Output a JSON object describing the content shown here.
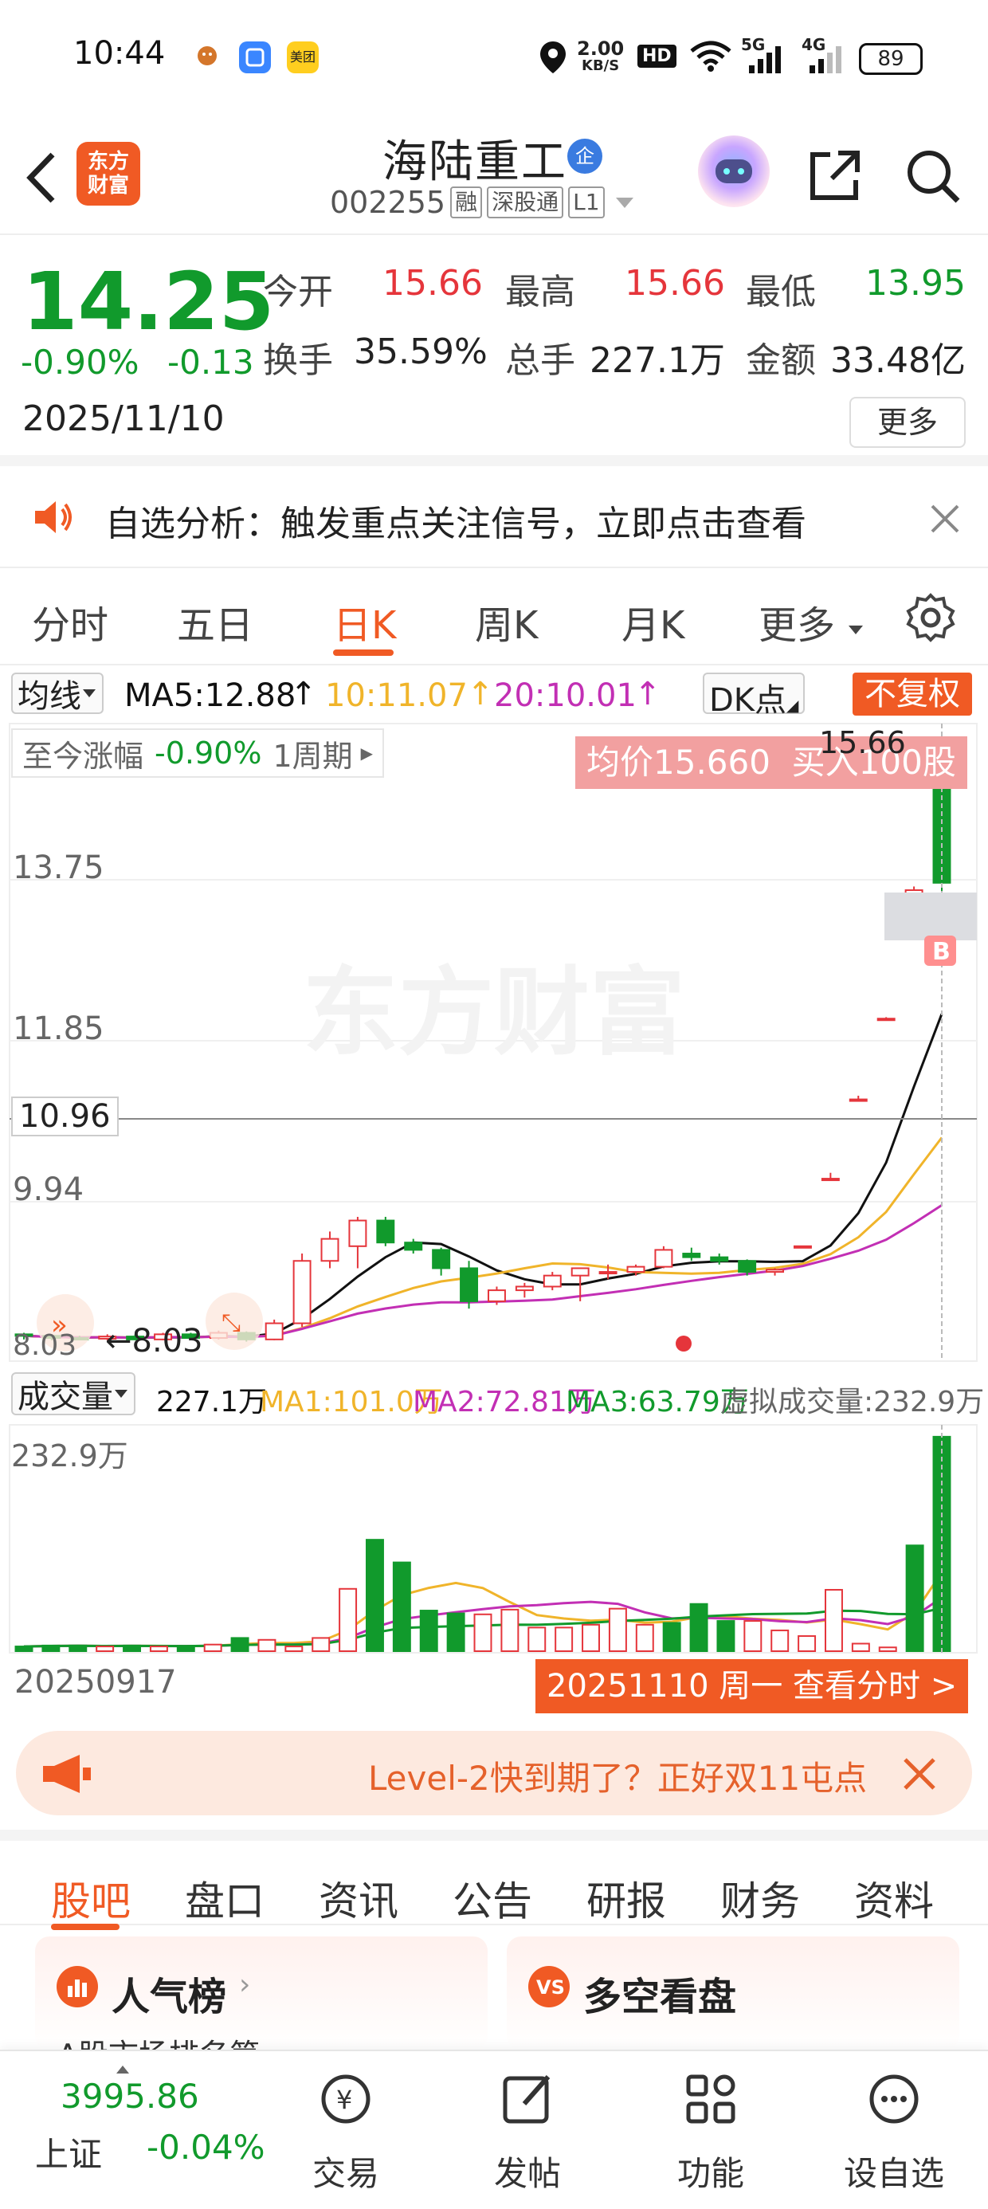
{
  "status_bar": {
    "time": "10:44",
    "net_speed_value": "2.00",
    "net_speed_unit": "KB/S",
    "hd_label": "HD",
    "sig1_label": "5G",
    "sig2_label": "4G",
    "battery": "89",
    "app3_label": "美团"
  },
  "header": {
    "logo_line1": "东方",
    "logo_line2": "财富",
    "stock_name": "海陆重工",
    "badge": "企",
    "stock_code": "002255",
    "tags": [
      "融",
      "深股通",
      "L1"
    ]
  },
  "quote": {
    "price": "14.25",
    "change_pct": "-0.90%",
    "change_amt": "-0.13",
    "date": "2025/11/10",
    "open_label": "今开",
    "open": "15.66",
    "high_label": "最高",
    "high": "15.66",
    "low_label": "最低",
    "low": "13.95",
    "turnover_label": "换手",
    "turnover": "35.59%",
    "volume_label": "总手",
    "volume": "227.1万",
    "amount_label": "金额",
    "amount": "33.48亿",
    "more_label": "更多"
  },
  "analysis": {
    "text": "自选分析：触发重点关注信号，立即点击查看"
  },
  "chart_tabs": [
    "分时",
    "五日",
    "日K",
    "周K",
    "月K",
    "更多"
  ],
  "ma_bar": {
    "ma_select": "均线",
    "ma5": "MA5:12.88",
    "ma10": "10:11.07",
    "ma20": "20:10.01",
    "dk": "DK点",
    "adjust": "不复权"
  },
  "chart_overlay": {
    "period_label": "至今涨幅",
    "period_change": "-0.90%",
    "period_count": "1周期",
    "trade_banner": "均价15.660  买入100股",
    "max_label": "15.66",
    "min_label": "8.03",
    "buy_marker": "B",
    "crosshair_price": "10.96",
    "watermark": "东方财富",
    "y_ticks": [
      "13.75",
      "11.85",
      "9.94",
      "8.03"
    ]
  },
  "volume_bar": {
    "select": "成交量",
    "current": "227.1万",
    "ma1": "MA1:101.0万",
    "ma2": "MA2:72.81万",
    "ma3": "MA3:63.79万",
    "virtual": "虚拟成交量:232.9万",
    "max_label": "232.9万"
  },
  "x_axis": {
    "start_date": "20250917",
    "cursor_label": "20251110 周一 查看分时 >"
  },
  "colors": {
    "up": "#e5353b",
    "down": "#119a2c",
    "ma5": "#111111",
    "ma10": "#f0b42a",
    "ma20": "#c22fb4",
    "accent": "#f05a24"
  },
  "chart_data": {
    "type": "candlestick",
    "x": [
      "20250917",
      "20251110"
    ],
    "ohlc": [
      [
        8.1,
        8.12,
        8.03,
        8.08
      ],
      [
        8.08,
        8.1,
        8.02,
        8.05
      ],
      [
        8.05,
        8.08,
        8.02,
        8.04
      ],
      [
        8.04,
        8.1,
        8.02,
        8.07
      ],
      [
        8.07,
        8.1,
        8.02,
        8.03
      ],
      [
        8.03,
        8.12,
        8.02,
        8.1
      ],
      [
        8.1,
        8.12,
        8.03,
        8.05
      ],
      [
        8.05,
        8.15,
        8.03,
        8.12
      ],
      [
        8.12,
        8.14,
        8.0,
        8.03
      ],
      [
        8.03,
        8.3,
        8.02,
        8.25
      ],
      [
        8.25,
        9.2,
        8.2,
        9.1
      ],
      [
        9.1,
        9.5,
        9.0,
        9.4
      ],
      [
        9.3,
        9.7,
        9.0,
        9.65
      ],
      [
        9.65,
        9.7,
        9.3,
        9.35
      ],
      [
        9.35,
        9.4,
        9.2,
        9.25
      ],
      [
        9.25,
        9.28,
        8.9,
        9.0
      ],
      [
        9.0,
        9.1,
        8.45,
        8.55
      ],
      [
        8.55,
        8.75,
        8.5,
        8.7
      ],
      [
        8.7,
        8.8,
        8.6,
        8.75
      ],
      [
        8.75,
        8.95,
        8.7,
        8.9
      ],
      [
        8.9,
        9.0,
        8.55,
        9.0
      ],
      [
        8.95,
        9.05,
        8.85,
        8.95
      ],
      [
        8.95,
        9.05,
        8.9,
        9.02
      ],
      [
        9.02,
        9.3,
        9.0,
        9.25
      ],
      [
        9.2,
        9.28,
        9.1,
        9.15
      ],
      [
        9.15,
        9.2,
        9.05,
        9.1
      ],
      [
        9.1,
        9.12,
        8.9,
        8.95
      ],
      [
        8.95,
        9.0,
        8.9,
        8.98
      ],
      [
        9.3,
        9.3,
        9.3,
        9.3
      ],
      [
        10.2,
        10.3,
        10.2,
        10.22
      ],
      [
        11.3,
        11.35,
        11.3,
        11.3
      ],
      [
        12.4,
        12.42,
        12.4,
        12.4
      ],
      [
        13.6,
        14.2,
        13.55,
        14.15
      ],
      [
        15.66,
        15.66,
        13.95,
        14.25
      ]
    ],
    "volumes": [
      5,
      6,
      6,
      5,
      6,
      5,
      5,
      7,
      14,
      12,
      5,
      14,
      66,
      118,
      94,
      43,
      40,
      39,
      44,
      25,
      25,
      28,
      45,
      28,
      30,
      50,
      32,
      32,
      22,
      16,
      65,
      8,
      4,
      112,
      227.1
    ],
    "y_axis_ticks": [
      13.75,
      11.85,
      9.94,
      8.03
    ],
    "max_value": 15.66,
    "min_value": 8.03,
    "volume_max": 232.9,
    "ma_lines": [
      "MA5",
      "10",
      "20"
    ]
  },
  "level2_banner": {
    "text": "Level-2快到期了？正好双11屯点"
  },
  "content_tabs": [
    "股吧",
    "盘口",
    "资讯",
    "公告",
    "研报",
    "财务",
    "资料"
  ],
  "cards": [
    {
      "title": "人气榜",
      "subtitle": "A股市场排名第"
    },
    {
      "title": "多空看盘"
    }
  ],
  "bottom_nav": {
    "index_value": "3995.86",
    "index_name": "上证",
    "index_change": "-0.04%",
    "items": [
      "交易",
      "发帖",
      "功能",
      "设自选"
    ]
  }
}
